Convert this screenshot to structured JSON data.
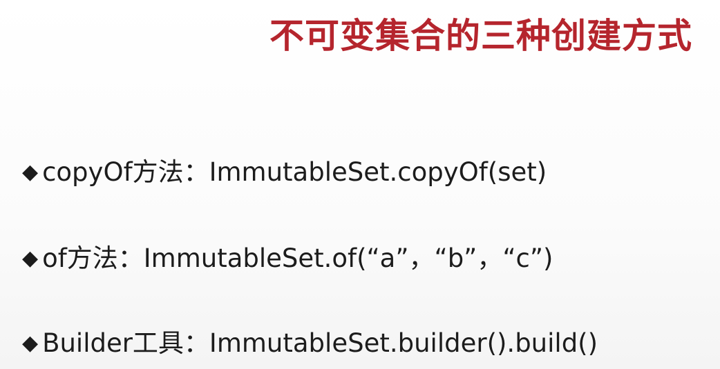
{
  "title": "不可变集合的三种创建方式",
  "bullet_symbol": "◆",
  "items": [
    {
      "text": "copyOf方法：ImmutableSet.copyOf(set)"
    },
    {
      "text": "of方法：ImmutableSet.of(“a”，“b”，“c”)"
    },
    {
      "text": "Builder工具：ImmutableSet.builder().build()"
    }
  ],
  "colors": {
    "title": "#b5252d",
    "body_text": "#1c1c1c",
    "background": "#ffffff"
  }
}
